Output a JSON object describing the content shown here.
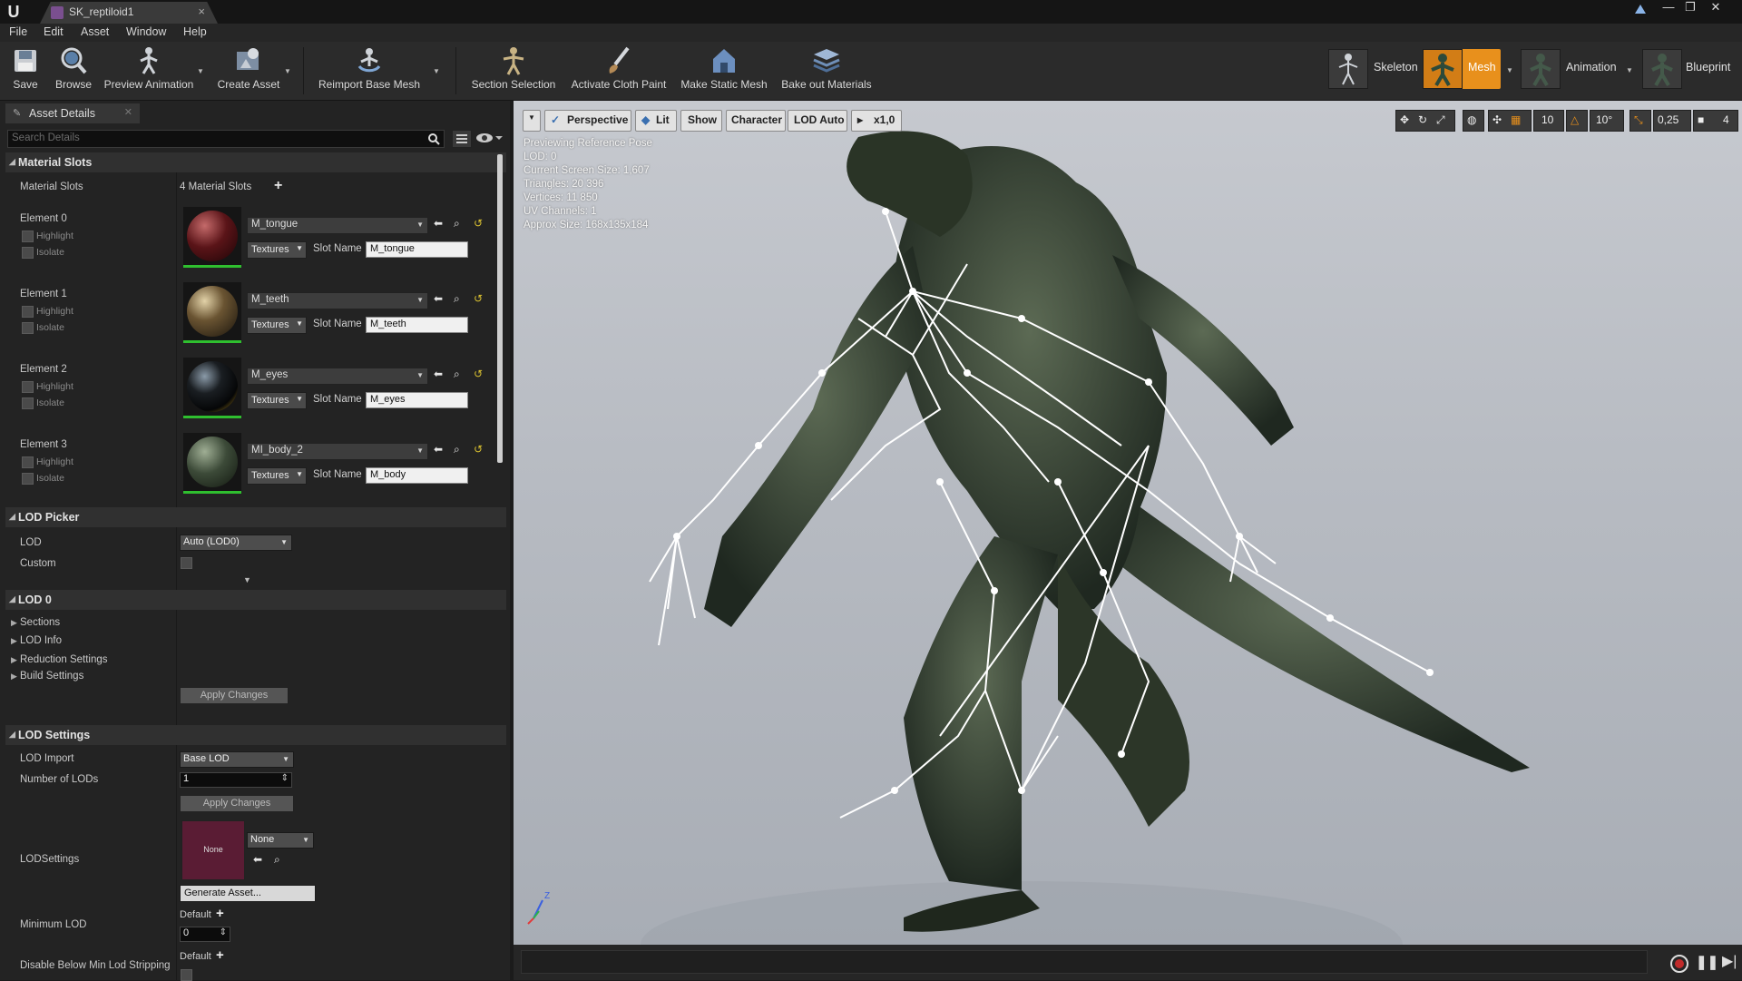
{
  "window": {
    "tab_title": "SK_reptiloid1",
    "logo": "U",
    "controls": [
      "—",
      "❐",
      "✕"
    ]
  },
  "menu": [
    "File",
    "Edit",
    "Asset",
    "Window",
    "Help"
  ],
  "toolbar": {
    "items": [
      {
        "label": "Save",
        "icon": "save-icon"
      },
      {
        "label": "Browse",
        "icon": "browse-icon"
      },
      {
        "label": "Preview Animation",
        "icon": "preview-animation-icon"
      },
      {
        "label": "Create Asset",
        "icon": "create-asset-icon"
      },
      {
        "label": "Reimport Base Mesh",
        "icon": "reimport-icon"
      },
      {
        "label": "Section Selection",
        "icon": "section-selection-icon"
      },
      {
        "label": "Activate Cloth Paint",
        "icon": "cloth-paint-icon"
      },
      {
        "label": "Make Static Mesh",
        "icon": "static-mesh-icon"
      },
      {
        "label": "Bake out Materials",
        "icon": "bake-materials-icon"
      }
    ],
    "modes": [
      {
        "label": "Skeleton",
        "active": false
      },
      {
        "label": "Mesh",
        "active": true
      },
      {
        "label": "Animation",
        "active": false
      },
      {
        "label": "Blueprint",
        "active": false
      }
    ],
    "accent": "#e8901c"
  },
  "details": {
    "tab_label": "Asset Details",
    "search_placeholder": "Search Details",
    "material_slots": {
      "header": "Material Slots",
      "row_label": "Material Slots",
      "count_text": "4 Material Slots",
      "elements": [
        {
          "label": "Element 0",
          "material": "M_tongue",
          "slot_name": "M_tongue",
          "sphere_color": "#5a1418"
        },
        {
          "label": "Element 1",
          "material": "M_teeth",
          "slot_name": "M_teeth",
          "sphere_color": "#4a3a22"
        },
        {
          "label": "Element 2",
          "material": "M_eyes",
          "slot_name": "M_eyes",
          "sphere_color": "#14171a"
        },
        {
          "label": "Element 3",
          "material": "MI_body_2",
          "slot_name": "M_body",
          "sphere_color": "#3c4a38"
        }
      ],
      "highlight_label": "Highlight",
      "isolate_label": "Isolate",
      "textures_label": "Textures",
      "slot_name_label": "Slot Name"
    },
    "lod_picker": {
      "header": "LOD Picker",
      "lod_label": "LOD",
      "lod_value": "Auto (LOD0)",
      "custom_label": "Custom"
    },
    "lod0": {
      "header": "LOD 0",
      "items": [
        "Sections",
        "LOD Info",
        "Reduction Settings",
        "Build Settings"
      ],
      "apply_label": "Apply Changes"
    },
    "lod_settings": {
      "header": "LOD Settings",
      "lod_import_label": "LOD Import",
      "lod_import_value": "Base LOD",
      "num_lods_label": "Number of LODs",
      "num_lods_value": "1",
      "apply_label": "Apply Changes",
      "lodsettings_label": "LODSettings",
      "lodsettings_thumb": "None",
      "lodsettings_value": "None",
      "generate_label": "Generate Asset...",
      "min_lod_label": "Minimum LOD",
      "min_lod_default": "Default",
      "min_lod_value": "0",
      "disable_label": "Disable Below Min Lod Stripping",
      "disable_default": "Default"
    }
  },
  "viewport": {
    "buttons": [
      "Perspective",
      "Lit",
      "Show",
      "Character",
      "LOD Auto",
      "x1,0"
    ],
    "overlay": [
      "Previewing Reference Pose",
      "LOD: 0",
      "Current Screen Size: 1,607",
      "Triangles: 20 396",
      "Vertices: 11 850",
      "UV Channels: 1",
      "Approx Size: 168x135x184"
    ],
    "right_tools": [
      "10",
      "10°",
      "0,25",
      "4"
    ],
    "axis_label": "Z"
  }
}
